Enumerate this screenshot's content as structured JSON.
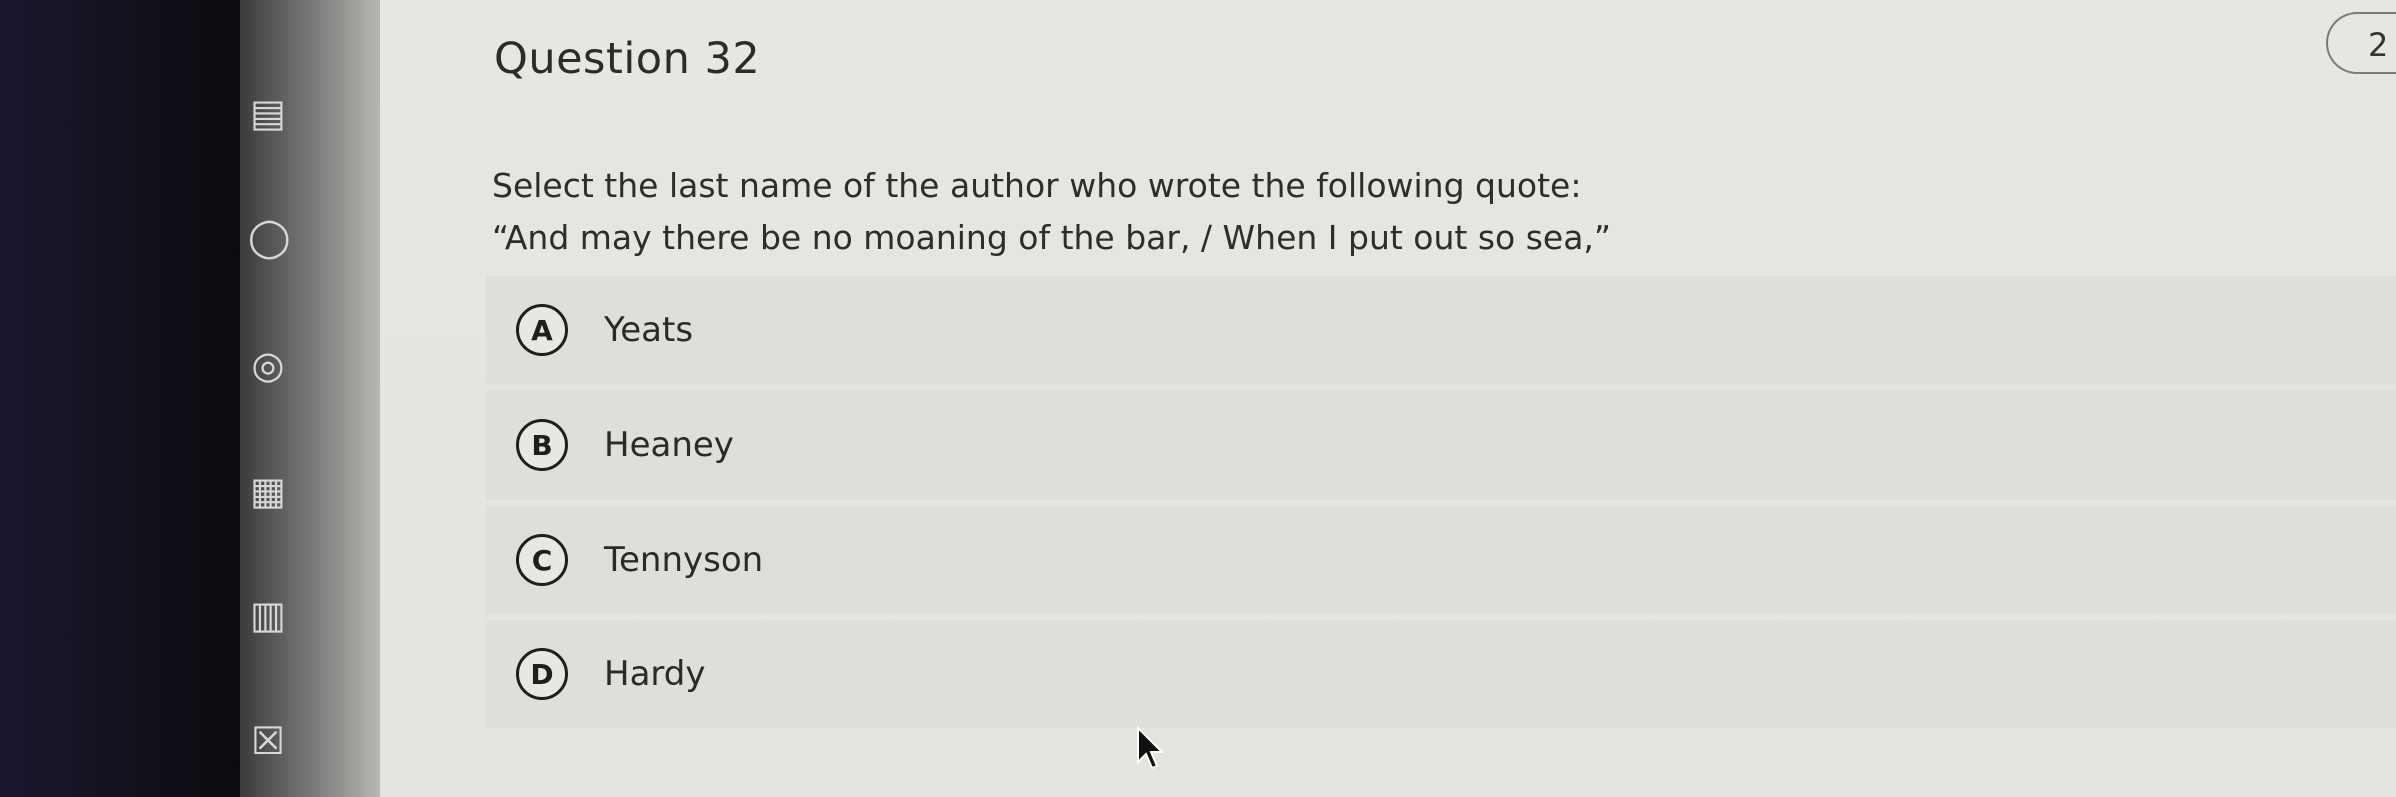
{
  "question": {
    "title": "Question 32",
    "badge": "2",
    "prompt_line1": "Select the last name of the author who wrote the following quote:",
    "prompt_line2": "“And may there be no moaning of the bar, / When I put out so sea,”"
  },
  "options": [
    {
      "letter": "A",
      "label": "Yeats"
    },
    {
      "letter": "B",
      "label": "Heaney"
    },
    {
      "letter": "C",
      "label": "Tennyson"
    },
    {
      "letter": "D",
      "label": "Hardy"
    }
  ],
  "rail_icons": [
    "bank-icon",
    "user-icon",
    "globe-icon",
    "gradebook-icon",
    "calendar-icon",
    "inbox-icon"
  ]
}
